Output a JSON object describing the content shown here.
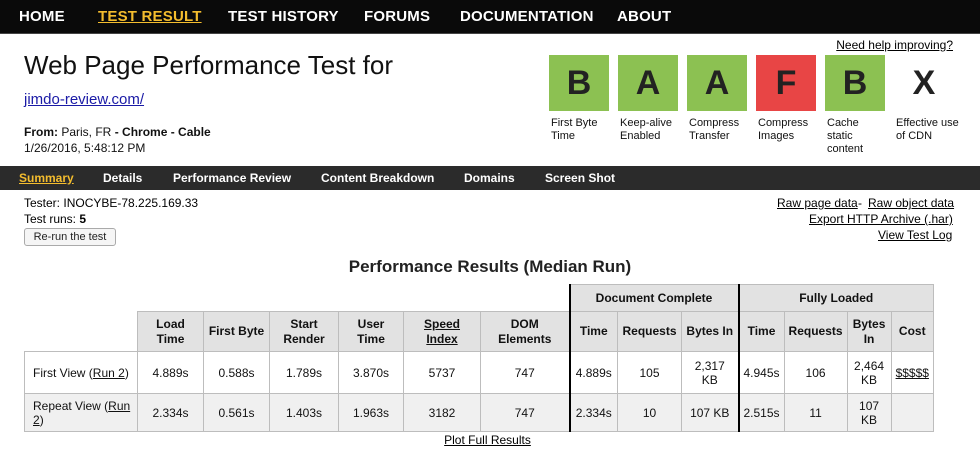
{
  "nav": {
    "items": [
      {
        "label": "HOME",
        "active": false
      },
      {
        "label": "TEST RESULT",
        "active": true
      },
      {
        "label": "TEST HISTORY",
        "active": false
      },
      {
        "label": "FORUMS",
        "active": false
      },
      {
        "label": "DOCUMENTATION",
        "active": false
      },
      {
        "label": "ABOUT",
        "active": false
      }
    ]
  },
  "header": {
    "title": "Web Page Performance Test for",
    "site": "jimdo-review.com/",
    "from_label": "From:",
    "location": "Paris, FR",
    "sep1": " - ",
    "browser": "Chrome",
    "sep2": " - ",
    "connection": "Cable",
    "date": "1/26/2016, 5:48:12 PM",
    "help": "Need help improving?"
  },
  "grades": [
    {
      "grade": "B",
      "label": "First Byte Time",
      "color": "#8cc152"
    },
    {
      "grade": "A",
      "label": "Keep-alive Enabled",
      "color": "#8cc152"
    },
    {
      "grade": "A",
      "label": "Compress Transfer",
      "color": "#8cc152"
    },
    {
      "grade": "F",
      "label": "Compress Images",
      "color": "#e84545"
    },
    {
      "grade": "B",
      "label": "Cache static content",
      "color": "#8cc152"
    },
    {
      "grade": "X",
      "label": "Effective use of CDN",
      "color": "#ffffff"
    }
  ],
  "subnav": {
    "items": [
      {
        "label": "Summary",
        "active": true
      },
      {
        "label": "Details",
        "active": false
      },
      {
        "label": "Performance Review",
        "active": false
      },
      {
        "label": "Content Breakdown",
        "active": false
      },
      {
        "label": "Domains",
        "active": false
      },
      {
        "label": "Screen Shot",
        "active": false
      }
    ]
  },
  "info": {
    "tester_label": "Tester:",
    "tester": "INOCYBE-78.225.169.33",
    "runs_label": "Test runs:",
    "runs": "5",
    "rerun": "Re-run the test"
  },
  "links": {
    "raw_page": "Raw page data",
    "sep": " - ",
    "raw_object": "Raw object data",
    "export_har": "Export HTTP Archive (.har)",
    "view_log": "View Test Log"
  },
  "results": {
    "title": "Performance Results (Median Run)",
    "group_doc": "Document Complete",
    "group_full": "Fully Loaded",
    "headers": {
      "load_time": "Load Time",
      "first_byte": "First Byte",
      "start_render": "Start Render",
      "user_time": "User Time",
      "speed_index": "Speed Index",
      "dom_elements": "DOM Elements",
      "doc_time": "Time",
      "doc_requests": "Requests",
      "doc_bytes": "Bytes In",
      "full_time": "Time",
      "full_requests": "Requests",
      "full_bytes": "Bytes In",
      "cost": "Cost"
    },
    "rows": [
      {
        "label_prefix": "First View (",
        "run_link": "Run 2",
        "label_suffix": ")",
        "load_time": "4.889s",
        "first_byte": "0.588s",
        "start_render": "1.789s",
        "user_time": "3.870s",
        "speed_index": "5737",
        "dom_elements": "747",
        "doc_time": "4.889s",
        "doc_requests": "105",
        "doc_bytes": "2,317 KB",
        "full_time": "4.945s",
        "full_requests": "106",
        "full_bytes": "2,464 KB",
        "cost": "$$$$$"
      },
      {
        "label_prefix": "Repeat View (",
        "run_link": "Run 2",
        "label_suffix": ")",
        "load_time": "2.334s",
        "first_byte": "0.561s",
        "start_render": "1.403s",
        "user_time": "1.963s",
        "speed_index": "3182",
        "dom_elements": "747",
        "doc_time": "2.334s",
        "doc_requests": "10",
        "doc_bytes": "107 KB",
        "full_time": "2.515s",
        "full_requests": "11",
        "full_bytes": "107 KB",
        "cost": ""
      }
    ],
    "plot_link": "Plot Full Results"
  }
}
